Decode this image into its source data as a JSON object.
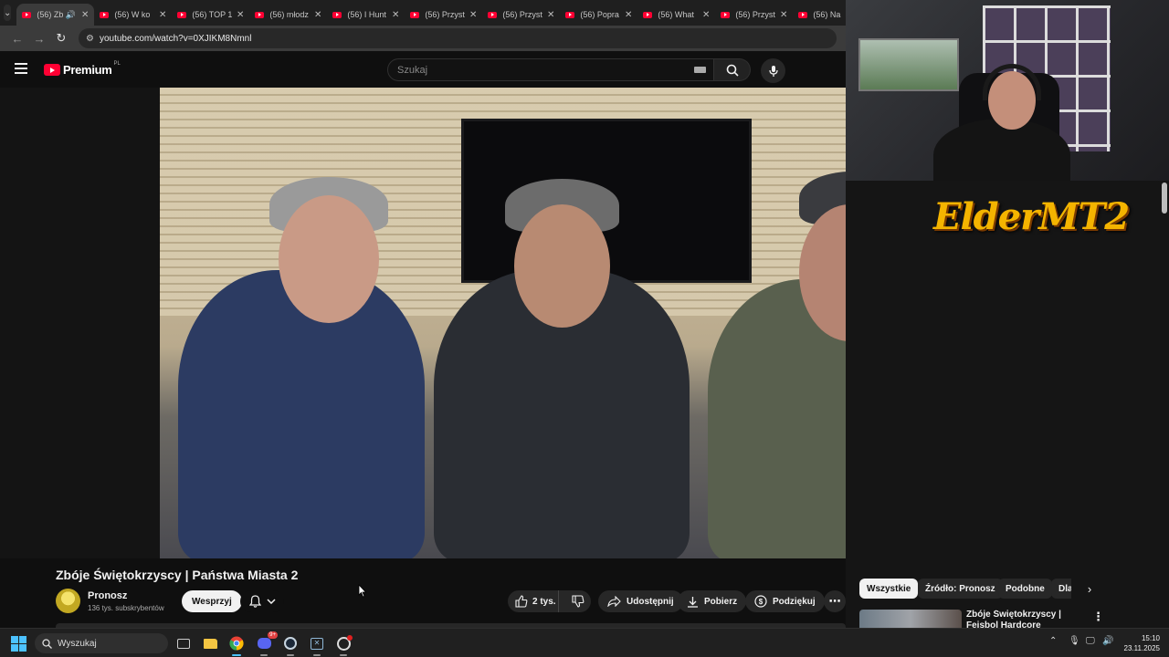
{
  "browser": {
    "tabs": [
      {
        "title": "(56) Zb",
        "active": true,
        "audio": true
      },
      {
        "title": "(56) W ko",
        "active": false
      },
      {
        "title": "(56) TOP 1",
        "active": false
      },
      {
        "title": "(56) młodz",
        "active": false
      },
      {
        "title": "(56) I Hunt",
        "active": false
      },
      {
        "title": "(56) Przyst",
        "active": false
      },
      {
        "title": "(56) Przyst",
        "active": false
      },
      {
        "title": "(56) Popra",
        "active": false
      },
      {
        "title": "(56) What",
        "active": false
      },
      {
        "title": "(56) Przyst",
        "active": false
      },
      {
        "title": "(56) Na",
        "active": false
      }
    ],
    "url": "youtube.com/watch?v=0XJIKM8Nmnl",
    "icons": {
      "back": "arrow-left-icon",
      "forward": "arrow-right-icon",
      "reload": "reload-icon",
      "site": "site-settings-icon"
    }
  },
  "youtube": {
    "logo_text": "Premium",
    "region": "PL",
    "search_placeholder": "Szukaj",
    "video": {
      "title": "Zbóje Świętokrzyscy | Państwa Miasta 2",
      "channel_name": "Pronosz",
      "subscribers": "136 tys. subskrybentów",
      "join_label": "Wesprzyj",
      "likes": "2 tys.",
      "share_label": "Udostępnij",
      "download_label": "Pobierz",
      "thanks_label": "Podziękuj"
    },
    "chips": [
      "Wszystkie",
      "Źródło: Pronosz",
      "Podobne",
      "Dla"
    ],
    "related": [
      {
        "title": "Zbóje Świętokrzyscy | Fejsbol Hardcore"
      }
    ]
  },
  "overlay": {
    "logo_text": "ElderMT2"
  },
  "taskbar": {
    "search_placeholder": "Wyszukaj",
    "apps": [
      "task-view",
      "file-explorer",
      "chrome",
      "discord",
      "steam",
      "excel",
      "obs"
    ],
    "discord_badge": "9+",
    "time": "15:10",
    "date": "23.11.2025"
  },
  "colors": {
    "accent_red": "#ff0033",
    "background": "#0f0f0f",
    "chip_active": "#f1f1f1",
    "windows_blue": "#4cc2ff"
  }
}
